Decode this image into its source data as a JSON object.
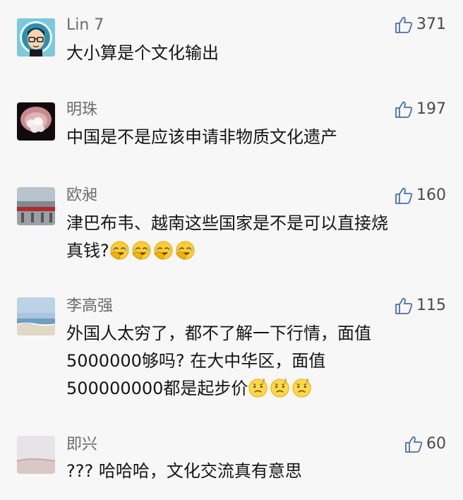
{
  "comments": [
    {
      "avatar_icon": "cartoon-man-glasses-avatar",
      "name": "Lin 7",
      "likes": "371",
      "text": "大小算是个文化输出",
      "emoji": [],
      "emoji_icon": ""
    },
    {
      "avatar_icon": "pearl-in-shell-avatar",
      "name": "明珠",
      "likes": "197",
      "text": "中国是不是应该申请非物质文化遗产",
      "emoji": [],
      "emoji_icon": ""
    },
    {
      "avatar_icon": "building-photo-avatar",
      "name": "欧昶",
      "likes": "160",
      "text": "津巴布韦、越南这些国家是不是可以直接烧\n真钱?",
      "emoji": [
        "facepalm-laugh",
        "facepalm-laugh",
        "facepalm-laugh",
        "facepalm-laugh"
      ],
      "emoji_icon": "facepalm-laugh-emoji-icon"
    },
    {
      "avatar_icon": "beach-photo-avatar",
      "name": "李高强",
      "likes": "115",
      "text": "外国人太穷了，都不了解一下行情，面值\n5000000够吗? 在大中华区，面值\n500000000都是起步价",
      "emoji": [
        "confused",
        "confused",
        "confused"
      ],
      "emoji_icon": "confused-emoji-icon"
    },
    {
      "avatar_icon": "pale-landscape-avatar",
      "name": "即兴",
      "likes": "60",
      "text": "??? 哈哈哈，文化交流真有意思",
      "emoji": [],
      "emoji_icon": ""
    }
  ],
  "like_icon": "thumbs-up-icon",
  "colors": {
    "background": "#f7f7f7",
    "name": "#6b6b6b",
    "text": "#151515",
    "like_count": "#4a4a4a"
  }
}
